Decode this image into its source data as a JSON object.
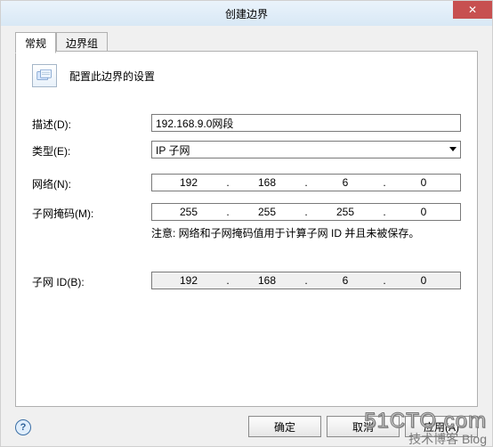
{
  "window": {
    "title": "创建边界",
    "close_glyph": "✕"
  },
  "tabs": {
    "general": "常规",
    "boundary_groups": "边界组"
  },
  "header": {
    "caption": "配置此边界的设置"
  },
  "labels": {
    "description": "描述(D):",
    "type": "类型(E):",
    "network": "网络(N):",
    "subnet_mask": "子网掩码(M):",
    "subnet_id": "子网 ID(B):"
  },
  "fields": {
    "description_value": "192.168.9.0网段",
    "type_value": "IP 子网",
    "network": {
      "a": "192",
      "b": "168",
      "c": "6",
      "d": "0"
    },
    "subnet_mask": {
      "a": "255",
      "b": "255",
      "c": "255",
      "d": "0"
    },
    "subnet_id": {
      "a": "192",
      "b": "168",
      "c": "6",
      "d": "0"
    },
    "note": "注意: 网络和子网掩码值用于计算子网 ID 并且未被保存。"
  },
  "buttons": {
    "ok": "确定",
    "cancel": "取消",
    "apply": "应用(A)"
  },
  "help_glyph": "?",
  "watermark": {
    "line1": "51CTO.com",
    "line2": "技术博客  Blog"
  }
}
